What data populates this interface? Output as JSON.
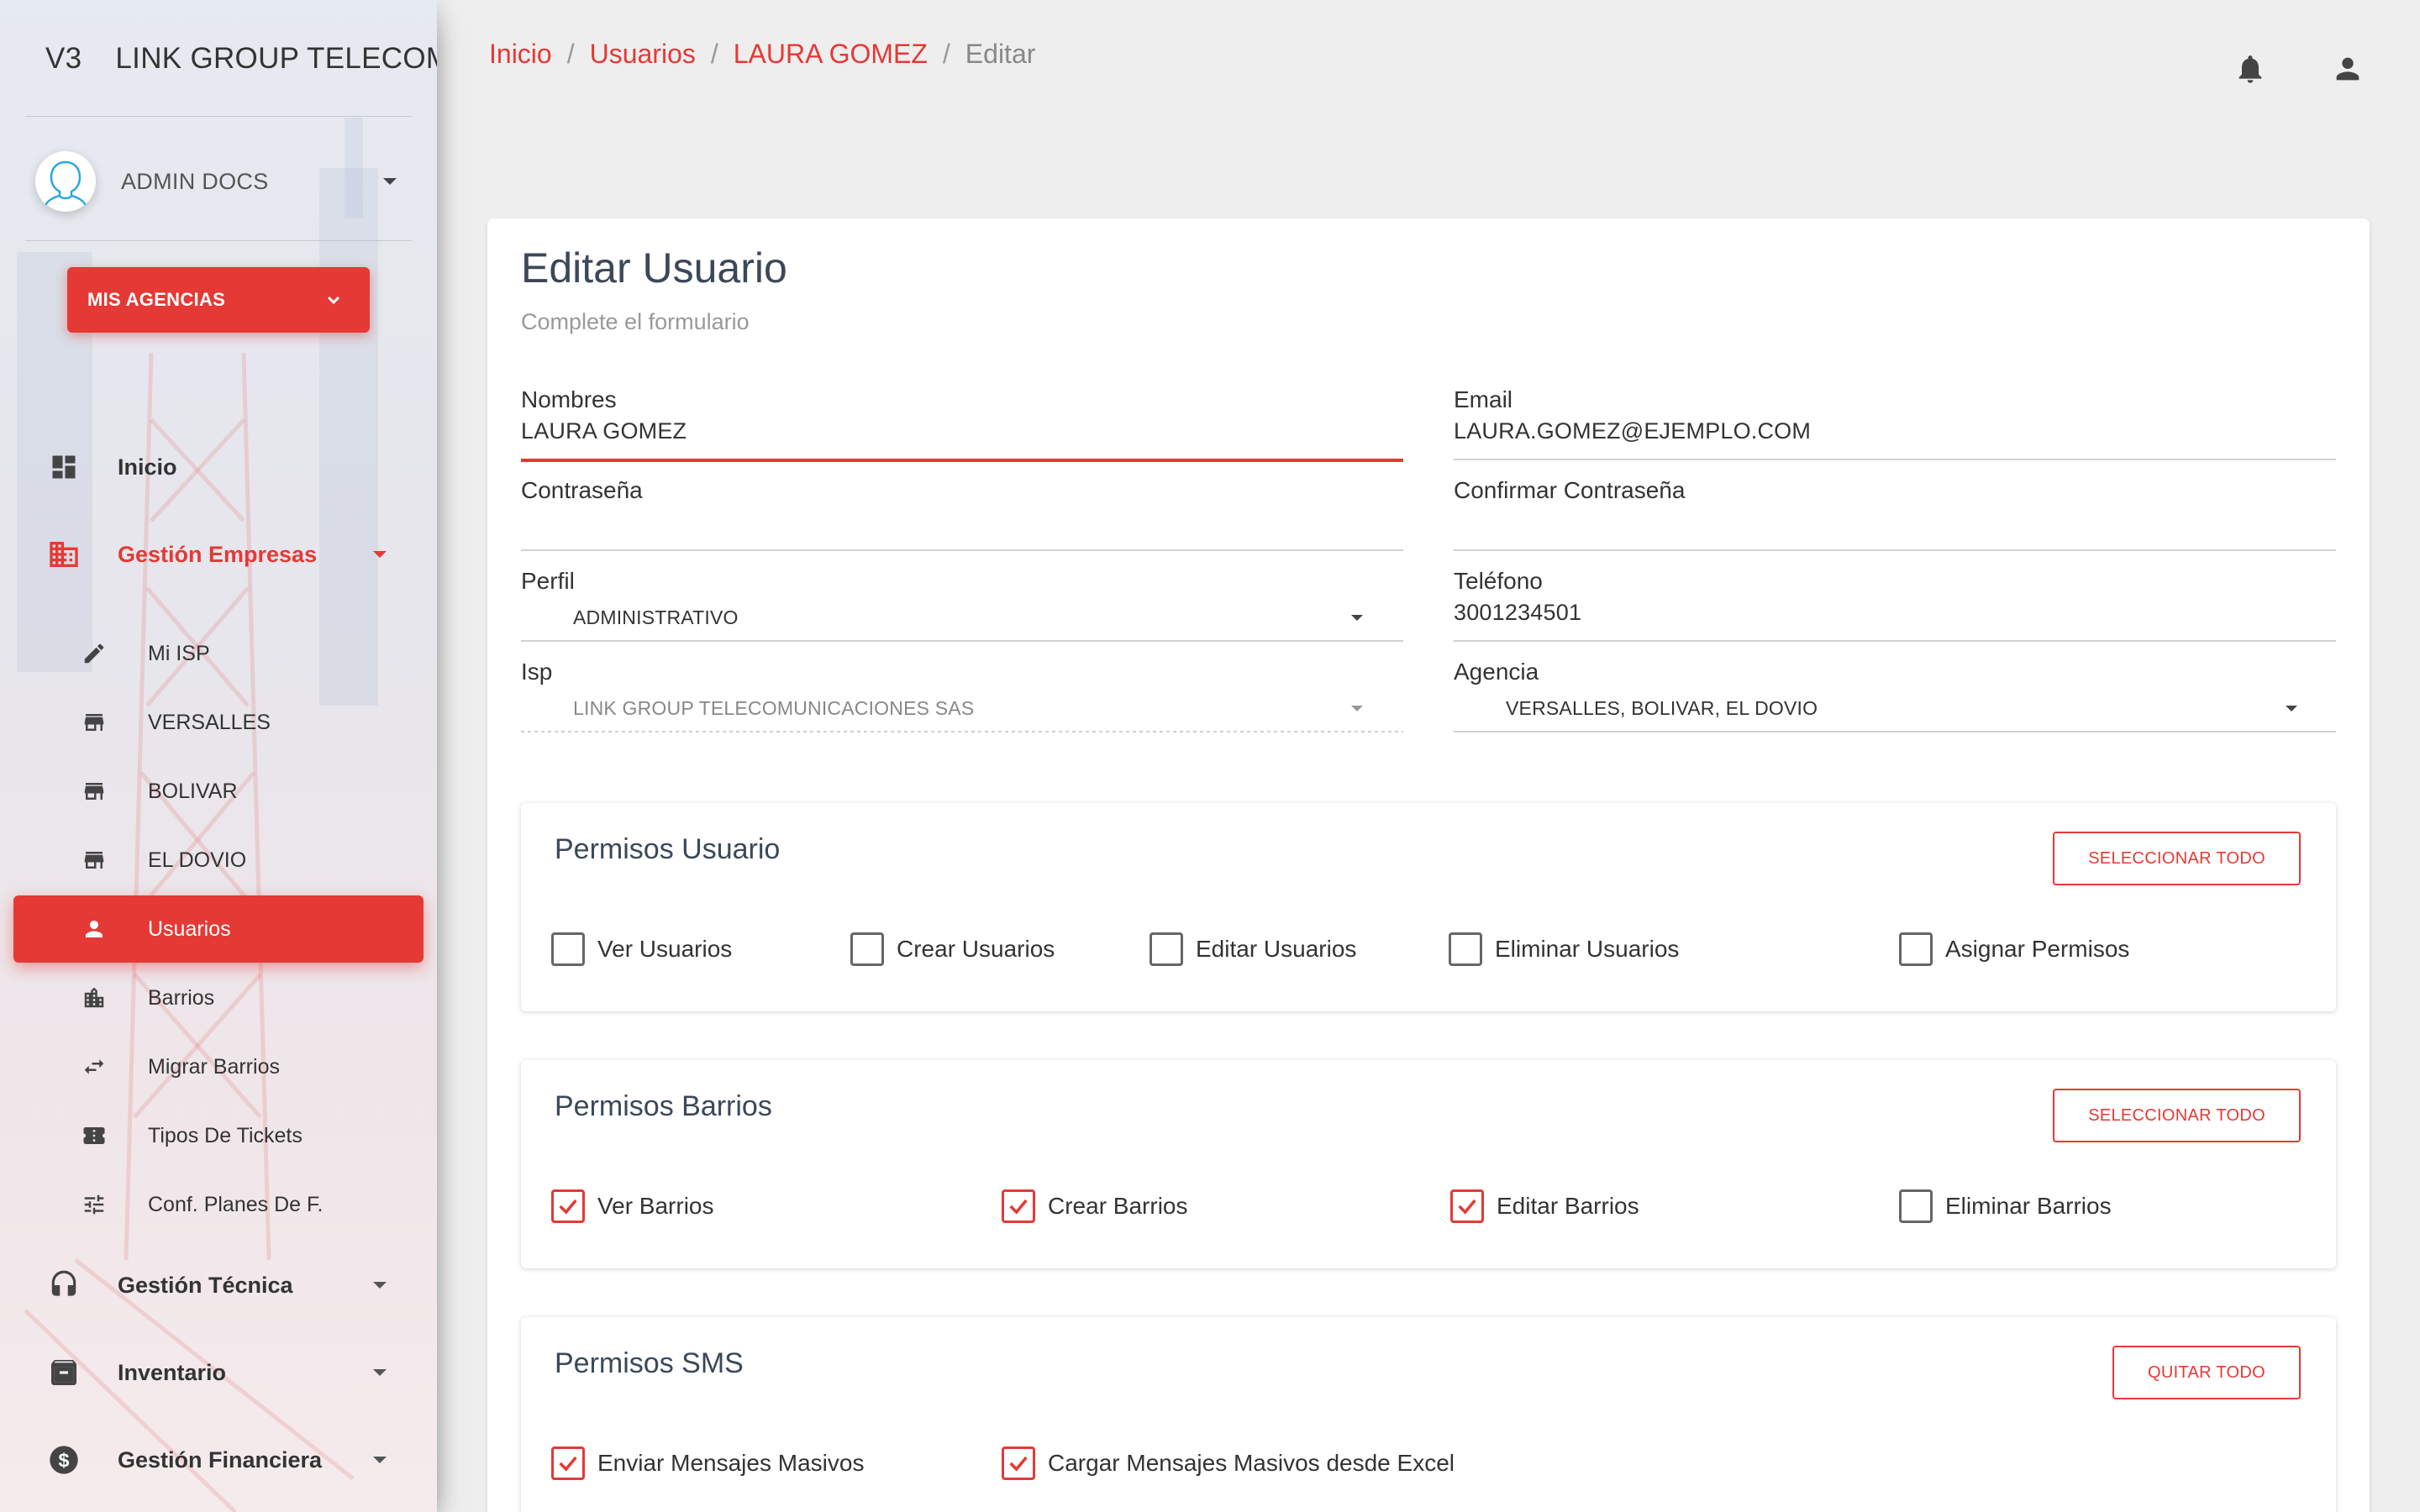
{
  "sidebar": {
    "brand_mini": "V3",
    "brand_full": "LINK GROUP TELECOMU",
    "user_name": "ADMIN DOCS",
    "agencias_label": "MIS AGENCIAS",
    "nav": {
      "inicio": "Inicio",
      "gestion_empresas": "Gestión Empresas",
      "gestion_tecnica": "Gestión Técnica",
      "inventario": "Inventario",
      "gestion_financiera": "Gestión Financiera"
    },
    "sub_items": [
      {
        "label": "Mi ISP",
        "icon": "pencil-icon"
      },
      {
        "label": "VERSALLES",
        "icon": "store-icon"
      },
      {
        "label": "BOLIVAR",
        "icon": "store-icon"
      },
      {
        "label": "EL DOVIO",
        "icon": "store-icon"
      },
      {
        "label": "Usuarios",
        "icon": "person-icon"
      },
      {
        "label": "Barrios",
        "icon": "city-icon"
      },
      {
        "label": "Migrar Barrios",
        "icon": "swap-icon"
      },
      {
        "label": "Tipos De Tickets",
        "icon": "ticket-icon"
      },
      {
        "label": "Conf. Planes De F.",
        "icon": "tune-icon"
      }
    ]
  },
  "breadcrumb": {
    "inicio": "Inicio",
    "usuarios": "Usuarios",
    "user": "LAURA GOMEZ",
    "current": "Editar",
    "separator": "/"
  },
  "form": {
    "title": "Editar Usuario",
    "subtitle": "Complete el formulario",
    "nombres": {
      "label": "Nombres",
      "value": "LAURA GOMEZ"
    },
    "email": {
      "label": "Email",
      "value": "LAURA.GOMEZ@EJEMPLO.COM"
    },
    "password": {
      "label": "Contraseña",
      "value": ""
    },
    "confirm_password": {
      "label": "Confirmar Contraseña",
      "value": ""
    },
    "perfil": {
      "label": "Perfil",
      "value": "ADMINISTRATIVO"
    },
    "telefono": {
      "label": "Teléfono",
      "value": "3001234501"
    },
    "isp": {
      "label": "Isp",
      "value": "LINK GROUP TELECOMUNICACIONES SAS"
    },
    "agencia": {
      "label": "Agencia",
      "value": "VERSALLES, BOLIVAR, EL DOVIO"
    }
  },
  "permisos_usuario": {
    "title": "Permisos Usuario",
    "button": "SELECCIONAR TODO",
    "items": [
      {
        "label": "Ver Usuarios",
        "checked": false
      },
      {
        "label": "Crear Usuarios",
        "checked": false
      },
      {
        "label": "Editar Usuarios",
        "checked": false
      },
      {
        "label": "Eliminar Usuarios",
        "checked": false
      },
      {
        "label": "Asignar Permisos",
        "checked": false
      }
    ]
  },
  "permisos_barrios": {
    "title": "Permisos Barrios",
    "button": "SELECCIONAR TODO",
    "items": [
      {
        "label": "Ver Barrios",
        "checked": true
      },
      {
        "label": "Crear Barrios",
        "checked": true
      },
      {
        "label": "Editar Barrios",
        "checked": true
      },
      {
        "label": "Eliminar Barrios",
        "checked": false
      }
    ]
  },
  "permisos_sms": {
    "title": "Permisos SMS",
    "button": "QUITAR TODO",
    "items": [
      {
        "label": "Enviar Mensajes Masivos",
        "checked": true
      },
      {
        "label": "Cargar Mensajes Masivos desde Excel",
        "checked": true
      }
    ]
  },
  "colors": {
    "accent": "#e53935",
    "text": "#3c4858"
  }
}
